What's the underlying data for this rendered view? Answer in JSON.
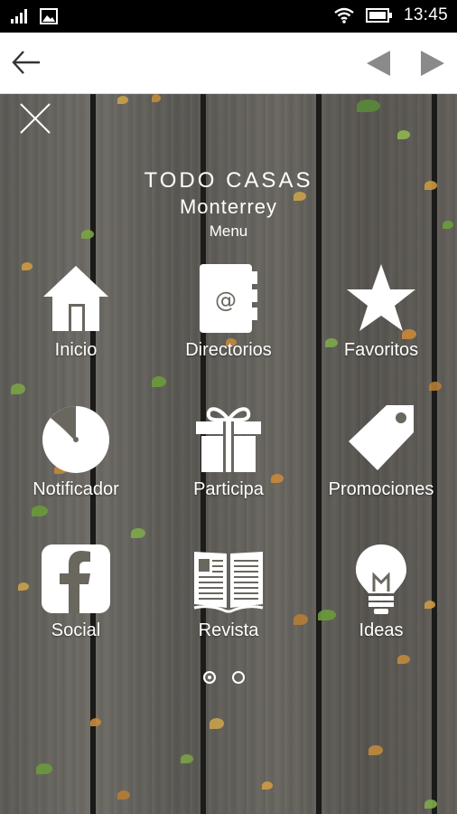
{
  "status_bar": {
    "time": "13:45",
    "icons": [
      "signal-icon",
      "image-icon",
      "wifi-icon",
      "battery-icon"
    ]
  },
  "nav": {
    "back_icon": "arrow-left-icon",
    "prev_icon": "triangle-left-icon",
    "next_icon": "triangle-right-icon"
  },
  "menu": {
    "close_icon": "close-icon",
    "brand_title": "TODO CASAS",
    "brand_city": "Monterrey",
    "brand_subtitle": "Menu",
    "items": [
      {
        "label": "Inicio",
        "icon": "home-icon"
      },
      {
        "label": "Directorios",
        "icon": "address-book-icon"
      },
      {
        "label": "Favoritos",
        "icon": "star-icon"
      },
      {
        "label": "Notificador",
        "icon": "pie-clock-icon"
      },
      {
        "label": "Participa",
        "icon": "gift-icon"
      },
      {
        "label": "Promociones",
        "icon": "tag-icon"
      },
      {
        "label": "Social",
        "icon": "facebook-icon"
      },
      {
        "label": "Revista",
        "icon": "magazine-icon"
      },
      {
        "label": "Ideas",
        "icon": "lightbulb-icon"
      }
    ],
    "pager": {
      "pages": 2,
      "active": 1
    }
  },
  "colors": {
    "status_bar_bg": "#000000",
    "nav_bg": "#ffffff",
    "nav_arrows": "#8a8a8a",
    "icon_color": "#ffffff"
  }
}
